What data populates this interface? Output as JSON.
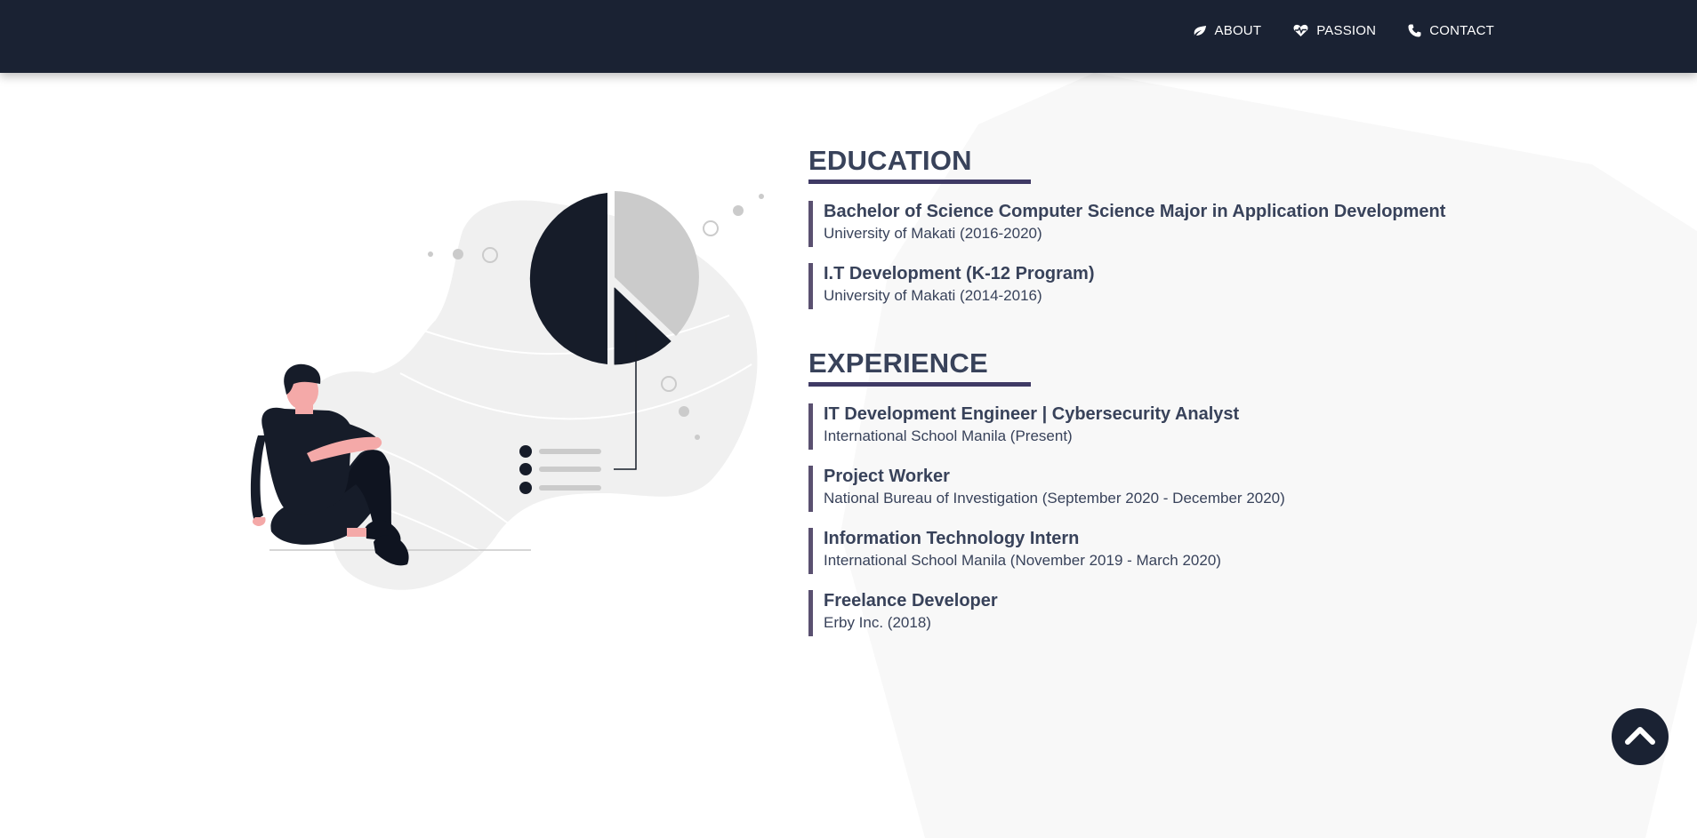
{
  "nav": {
    "items": [
      {
        "label": "ABOUT",
        "icon": "leaf-icon"
      },
      {
        "label": "PASSION",
        "icon": "heart-pulse-icon"
      },
      {
        "label": "CONTACT",
        "icon": "phone-icon"
      }
    ]
  },
  "education": {
    "heading": "EDUCATION",
    "entries": [
      {
        "title": "Bachelor of Science Computer Science Major in Application Development",
        "subtitle": "University of Makati (2016-2020)"
      },
      {
        "title": "I.T Development (K-12 Program)",
        "subtitle": "University of Makati (2014-2016)"
      }
    ]
  },
  "experience": {
    "heading": "EXPERIENCE",
    "entries": [
      {
        "title": "IT Development Engineer | Cybersecurity Analyst",
        "subtitle": "International School Manila (Present)"
      },
      {
        "title": "Project Worker",
        "subtitle": "National Bureau of Investigation (September 2020 - December 2020)"
      },
      {
        "title": "Information Technology Intern",
        "subtitle": "International School Manila (November 2019 - March 2020)"
      },
      {
        "title": "Freelance Developer",
        "subtitle": "Erby Inc. (2018)"
      }
    ]
  },
  "scroll_top": {
    "icon": "chevron-up-icon"
  },
  "colors": {
    "navbar": "#1a2233",
    "text": "#38425a",
    "accent": "#3f3a65",
    "entry_border": "#5a5070"
  }
}
